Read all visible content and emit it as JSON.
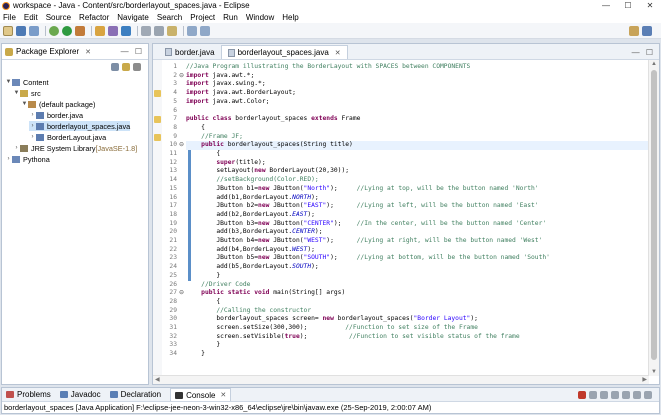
{
  "window": {
    "title": "workspace - Java - Content/src/borderlayout_spaces.java - Eclipse",
    "minimize": "—",
    "maximize": "☐",
    "close": "✕"
  },
  "menu": [
    "File",
    "Edit",
    "Source",
    "Refactor",
    "Navigate",
    "Search",
    "Project",
    "Run",
    "Window",
    "Help"
  ],
  "package_explorer": {
    "title": "Package Explorer",
    "close": "✕",
    "controls": "— ☐",
    "tree": [
      {
        "label": "Content",
        "depth": 0,
        "arrow": "▼",
        "icon": "project-icon",
        "color": "#6b88b8"
      },
      {
        "label": "src",
        "depth": 1,
        "arrow": "▼",
        "icon": "source-folder-icon",
        "color": "#c9a94a"
      },
      {
        "label": "(default package)",
        "depth": 2,
        "arrow": "▼",
        "icon": "package-icon",
        "color": "#b88a4a"
      },
      {
        "label": "border.java",
        "depth": 3,
        "arrow": "›",
        "icon": "java-file-icon",
        "color": "#5d7db0"
      },
      {
        "label": "borderlayout_spaces.java",
        "depth": 3,
        "arrow": "›",
        "icon": "java-file-icon",
        "color": "#5d7db0",
        "selected": true
      },
      {
        "label": "BorderLayout.java",
        "depth": 3,
        "arrow": "›",
        "icon": "java-file-icon",
        "color": "#5d7db0"
      },
      {
        "label": "JRE System Library",
        "decoration": "[JavaSE-1.8]",
        "depth": 1,
        "arrow": "›",
        "icon": "library-icon",
        "color": "#8a7d5a"
      },
      {
        "label": "Pythona",
        "depth": 0,
        "arrow": "›",
        "icon": "project-icon",
        "color": "#6b88b8"
      }
    ]
  },
  "editor": {
    "tabs": [
      {
        "label": "border.java",
        "active": false
      },
      {
        "label": "borderlayout_spaces.java",
        "active": true,
        "close": "✕"
      }
    ],
    "controls": "— ☐",
    "highlight_line": 10,
    "lines": [
      {
        "n": "1",
        "segs": [
          [
            "c",
            "//Java Program illustrating the BorderLayout with SPACES between COMPONENTS"
          ]
        ]
      },
      {
        "n": "2",
        "fold": "⊖",
        "segs": [
          [
            "k",
            "import"
          ],
          [
            "t",
            " java.awt.*;"
          ]
        ]
      },
      {
        "n": "3",
        "segs": [
          [
            "k",
            "import"
          ],
          [
            "t",
            " javax.swing.*;"
          ]
        ]
      },
      {
        "n": "4",
        "segs": [
          [
            "k",
            "import"
          ],
          [
            "t",
            " java.awt.BorderLayout;"
          ]
        ]
      },
      {
        "n": "5",
        "segs": [
          [
            "k",
            "import"
          ],
          [
            "t",
            " java.awt.Color;"
          ]
        ]
      },
      {
        "n": "6",
        "segs": []
      },
      {
        "n": "7",
        "segs": [
          [
            "k",
            "public class"
          ],
          [
            "t",
            " borderlayout_spaces "
          ],
          [
            "k",
            "extends"
          ],
          [
            "t",
            " Frame"
          ]
        ]
      },
      {
        "n": "8",
        "segs": [
          [
            "t",
            "    {"
          ]
        ]
      },
      {
        "n": "9",
        "segs": [
          [
            "c",
            "    //Frame JF;"
          ]
        ]
      },
      {
        "n": "10",
        "fold": "⊖",
        "segs": [
          [
            "t",
            "    "
          ],
          [
            "k",
            "public"
          ],
          [
            "t",
            " borderlayout_spaces(String title)"
          ]
        ]
      },
      {
        "n": "11",
        "segs": [
          [
            "t",
            "        {"
          ]
        ]
      },
      {
        "n": "12",
        "segs": [
          [
            "t",
            "        "
          ],
          [
            "k",
            "super"
          ],
          [
            "t",
            "(title);"
          ]
        ]
      },
      {
        "n": "13",
        "segs": [
          [
            "t",
            "        setLayout("
          ],
          [
            "k",
            "new"
          ],
          [
            "t",
            " BorderLayout(20,30));"
          ]
        ]
      },
      {
        "n": "14",
        "segs": [
          [
            "c",
            "        //setBackground(Color.RED);"
          ]
        ]
      },
      {
        "n": "15",
        "segs": [
          [
            "t",
            "        JButton b1="
          ],
          [
            "k",
            "new"
          ],
          [
            "t",
            " JButton("
          ],
          [
            "s",
            "\"North\""
          ],
          [
            "t",
            ");     "
          ],
          [
            "c",
            "//Lying at top, will be the button named 'North'"
          ]
        ]
      },
      {
        "n": "16",
        "segs": [
          [
            "t",
            "        add(b1,BorderLayout."
          ],
          [
            "f",
            "NORTH"
          ],
          [
            "t",
            ");"
          ]
        ]
      },
      {
        "n": "17",
        "segs": [
          [
            "t",
            "        JButton b2="
          ],
          [
            "k",
            "new"
          ],
          [
            "t",
            " JButton("
          ],
          [
            "s",
            "\"EAST\""
          ],
          [
            "t",
            ");      "
          ],
          [
            "c",
            "//Lying at left, will be the button named 'East'"
          ]
        ]
      },
      {
        "n": "18",
        "segs": [
          [
            "t",
            "        add(b2,BorderLayout."
          ],
          [
            "f",
            "EAST"
          ],
          [
            "t",
            ");"
          ]
        ]
      },
      {
        "n": "19",
        "segs": [
          [
            "t",
            "        JButton b3="
          ],
          [
            "k",
            "new"
          ],
          [
            "t",
            " JButton("
          ],
          [
            "s",
            "\"CENTER\""
          ],
          [
            "t",
            ");    "
          ],
          [
            "c",
            "//In the center, will be the button named 'Center'"
          ]
        ]
      },
      {
        "n": "20",
        "segs": [
          [
            "t",
            "        add(b3,BorderLayout."
          ],
          [
            "f",
            "CENTER"
          ],
          [
            "t",
            ");"
          ]
        ]
      },
      {
        "n": "21",
        "segs": [
          [
            "t",
            "        JButton b4="
          ],
          [
            "k",
            "new"
          ],
          [
            "t",
            " JButton("
          ],
          [
            "s",
            "\"WEST\""
          ],
          [
            "t",
            ");      "
          ],
          [
            "c",
            "//Lying at right, will be the button named 'West'"
          ]
        ]
      },
      {
        "n": "22",
        "segs": [
          [
            "t",
            "        add(b4,BorderLayout."
          ],
          [
            "f",
            "WEST"
          ],
          [
            "t",
            ");"
          ]
        ]
      },
      {
        "n": "23",
        "segs": [
          [
            "t",
            "        JButton b5="
          ],
          [
            "k",
            "new"
          ],
          [
            "t",
            " JButton("
          ],
          [
            "s",
            "\"SOUTH\""
          ],
          [
            "t",
            ");     "
          ],
          [
            "c",
            "//Lying at bottom, will be the button named 'South'"
          ]
        ]
      },
      {
        "n": "24",
        "segs": [
          [
            "t",
            "        add(b5,BorderLayout."
          ],
          [
            "f",
            "SOUTH"
          ],
          [
            "t",
            ");"
          ]
        ]
      },
      {
        "n": "25",
        "segs": [
          [
            "t",
            "        }"
          ]
        ]
      },
      {
        "n": "26",
        "segs": [
          [
            "c",
            "    //Driver Code"
          ]
        ]
      },
      {
        "n": "27",
        "fold": "⊖",
        "segs": [
          [
            "t",
            "    "
          ],
          [
            "k",
            "public static void"
          ],
          [
            "t",
            " main(String[] args)"
          ]
        ]
      },
      {
        "n": "28",
        "segs": [
          [
            "t",
            "        {"
          ]
        ]
      },
      {
        "n": "29",
        "segs": [
          [
            "c",
            "        //Calling the constructor"
          ]
        ]
      },
      {
        "n": "30",
        "segs": [
          [
            "t",
            "        borderlayout_spaces screen= "
          ],
          [
            "k",
            "new"
          ],
          [
            "t",
            " borderlayout_spaces("
          ],
          [
            "s",
            "\"Border Layout\""
          ],
          [
            "t",
            ");"
          ]
        ]
      },
      {
        "n": "31",
        "segs": [
          [
            "t",
            "        screen.setSize(300,300);          "
          ],
          [
            "c",
            "//Function to set size of the Frame"
          ]
        ]
      },
      {
        "n": "32",
        "segs": [
          [
            "t",
            "        screen.setVisible("
          ],
          [
            "k",
            "true"
          ],
          [
            "t",
            ");           "
          ],
          [
            "c",
            "//Function to set visible status of the frame"
          ]
        ]
      },
      {
        "n": "33",
        "segs": [
          [
            "t",
            "        }"
          ]
        ]
      },
      {
        "n": "34",
        "segs": [
          [
            "t",
            "    }"
          ]
        ]
      }
    ]
  },
  "console": {
    "tabs": [
      {
        "label": "Problems",
        "icon": "problems-icon",
        "color": "#c0504d"
      },
      {
        "label": "Javadoc",
        "icon": "javadoc-icon",
        "color": "#5b7fb5"
      },
      {
        "label": "Declaration",
        "icon": "declaration-icon",
        "color": "#5b7fb5"
      },
      {
        "label": "Console",
        "icon": "console-icon",
        "color": "#333333",
        "active": true,
        "close": "✕"
      }
    ],
    "status": "borderlayout_spaces [Java Application] F:\\eclipse-jee-neon-3-win32-x86_64\\eclipse\\jre\\bin\\javaw.exe (25-Sep-2019, 2:00:07 AM)"
  },
  "colors": {
    "keyword": "#7f0055",
    "comment": "#3f7f5f",
    "string": "#2a00ff",
    "field": "#0000c0",
    "text": "#000000"
  }
}
